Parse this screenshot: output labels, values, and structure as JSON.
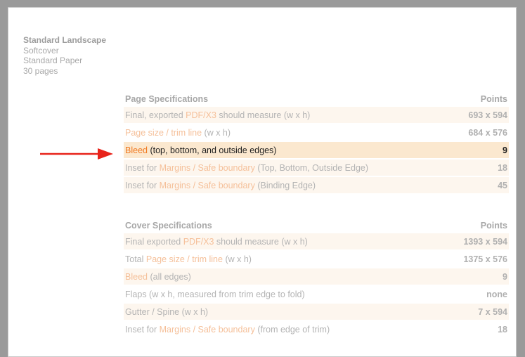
{
  "product": {
    "title": "Standard Landscape",
    "cover": "Softcover",
    "paper": "Standard Paper",
    "pages": "30 pages"
  },
  "page_specs": {
    "header": "Page Specifications",
    "units": "Points",
    "rows": [
      {
        "pre": "Final, exported ",
        "link": "PDF/X3",
        "post": " should measure (w x h)",
        "value": "693 x 594",
        "style": "alt"
      },
      {
        "pre": "",
        "link": "Page size / trim line",
        "post": " (w x h)",
        "value": "684 x 576",
        "style": "plain"
      },
      {
        "pre": "",
        "link": "Bleed",
        "post": " (top, bottom, and outside edges)",
        "value": "9",
        "style": "hl"
      },
      {
        "pre": "Inset for ",
        "link": "Margins / Safe boundary",
        "post": " (Top, Bottom, Outside Edge)",
        "value": "18",
        "style": "alt"
      },
      {
        "pre": "Inset for ",
        "link": "Margins / Safe boundary",
        "post": " (Binding Edge)",
        "value": "45",
        "style": "alt"
      }
    ]
  },
  "cover_specs": {
    "header": "Cover Specifications",
    "units": "Points",
    "rows": [
      {
        "pre": "Final exported ",
        "link": "PDF/X3",
        "post": " should measure (w x h)",
        "value": "1393 x 594",
        "style": "alt"
      },
      {
        "pre": "Total ",
        "link": "Page size / trim line",
        "post": " (w x h)",
        "value": "1375 x 576",
        "style": "plain"
      },
      {
        "pre": "",
        "link": "Bleed",
        "post": " (all edges)",
        "value": "9",
        "style": "alt"
      },
      {
        "pre": "Flaps (w x h, measured from trim edge to fold)",
        "link": "",
        "post": "",
        "value": "none",
        "style": "plain"
      },
      {
        "pre": "Gutter / Spine (w x h)",
        "link": "",
        "post": "",
        "value": "7 x 594",
        "style": "alt"
      },
      {
        "pre": "Inset for ",
        "link": "Margins / Safe boundary",
        "post": " (from edge of trim)",
        "value": "18",
        "style": "plain"
      }
    ]
  },
  "colors": {
    "highlight_row": "#fbe8cf",
    "alt_row": "#fdf6ee",
    "link_orange": "#f07a22",
    "arrow_red": "#e8231a"
  },
  "annotation": {
    "icon": "red-arrow-icon"
  }
}
